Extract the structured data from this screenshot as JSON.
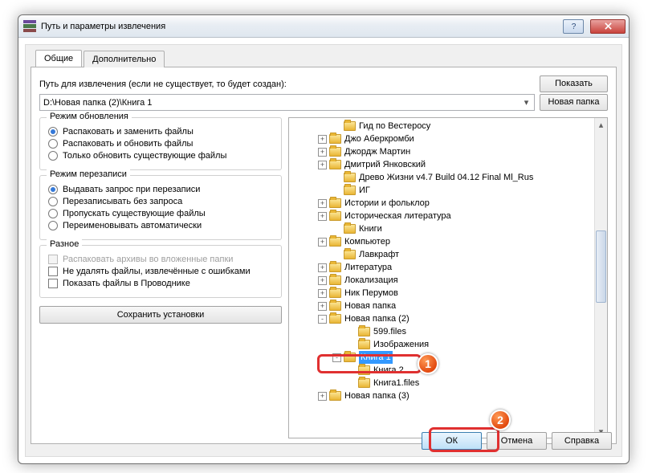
{
  "title": "Путь и параметры извлечения",
  "tabs": {
    "general": "Общие",
    "advanced": "Дополнительно"
  },
  "path_label": "Путь для извлечения (если не существует, то будет создан):",
  "path_value": "D:\\Новая папка (2)\\Книга 1",
  "buttons": {
    "show": "Показать",
    "newfolder": "Новая папка",
    "save": "Сохранить установки",
    "ok": "ОК",
    "cancel": "Отмена",
    "help": "Справка"
  },
  "groups": {
    "update": {
      "title": "Режим обновления",
      "opts": [
        "Распаковать и заменить файлы",
        "Распаковать и обновить файлы",
        "Только обновить существующие файлы"
      ]
    },
    "overwrite": {
      "title": "Режим перезаписи",
      "opts": [
        "Выдавать запрос при перезаписи",
        "Перезаписывать без запроса",
        "Пропускать существующие файлы",
        "Переименовывать автоматически"
      ]
    },
    "misc": {
      "title": "Разное",
      "opts": [
        "Распаковать архивы во вложенные папки",
        "Не удалять файлы, извлечённые с ошибками",
        "Показать файлы в Проводнике"
      ]
    }
  },
  "tree": [
    {
      "ind": 50,
      "exp": "",
      "label": "Гид по Вестеросу"
    },
    {
      "ind": 32,
      "exp": "+",
      "label": "Джо Аберкромби"
    },
    {
      "ind": 32,
      "exp": "+",
      "label": "Джордж Мартин"
    },
    {
      "ind": 32,
      "exp": "+",
      "label": "Дмитрий Янковский"
    },
    {
      "ind": 50,
      "exp": "",
      "label": "Древо Жизни v4.7 Build 04.12 Final Ml_Rus"
    },
    {
      "ind": 50,
      "exp": "",
      "label": "ИГ"
    },
    {
      "ind": 32,
      "exp": "+",
      "label": "Истории и фольклор"
    },
    {
      "ind": 32,
      "exp": "+",
      "label": "Историческая литература"
    },
    {
      "ind": 50,
      "exp": "",
      "label": "Книги"
    },
    {
      "ind": 32,
      "exp": "+",
      "label": "Компьютер"
    },
    {
      "ind": 50,
      "exp": "",
      "label": "Лавкрафт"
    },
    {
      "ind": 32,
      "exp": "+",
      "label": "Литература"
    },
    {
      "ind": 32,
      "exp": "+",
      "label": "Локализация"
    },
    {
      "ind": 32,
      "exp": "+",
      "label": "Ник Перумов"
    },
    {
      "ind": 32,
      "exp": "+",
      "label": "Новая папка"
    },
    {
      "ind": 32,
      "exp": "-",
      "label": "Новая папка (2)"
    },
    {
      "ind": 68,
      "exp": "",
      "label": "599.files"
    },
    {
      "ind": 68,
      "exp": "",
      "label": "Изображения"
    },
    {
      "ind": 50,
      "exp": "-",
      "label": "Книга 1",
      "sel": true
    },
    {
      "ind": 68,
      "exp": "",
      "label": "Книга 2"
    },
    {
      "ind": 68,
      "exp": "",
      "label": "Книга1.files"
    },
    {
      "ind": 32,
      "exp": "+",
      "label": "Новая папка (3)"
    }
  ],
  "callouts": {
    "c1": "1",
    "c2": "2"
  }
}
